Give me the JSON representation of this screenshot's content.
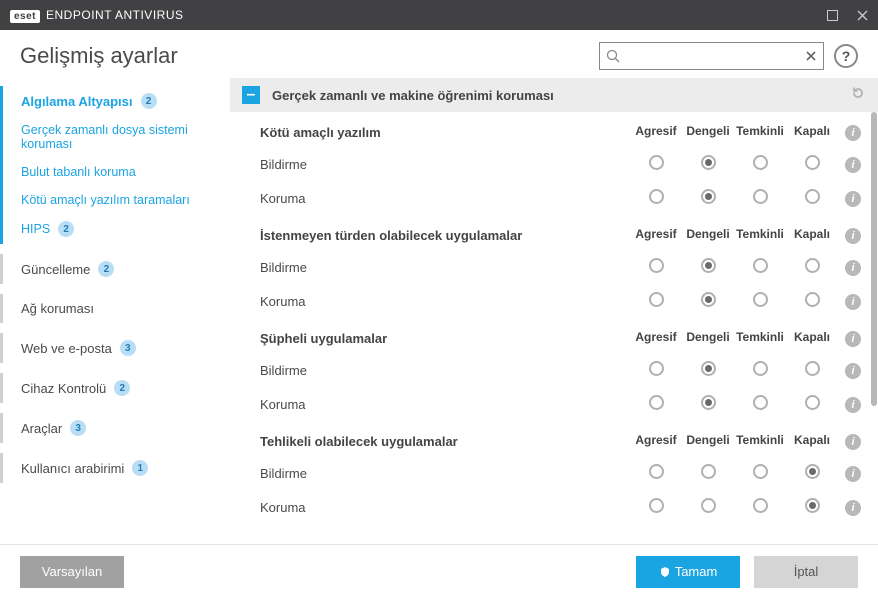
{
  "app": {
    "brand_prefix": "eset",
    "brand": "ENDPOINT ANTIVIRUS"
  },
  "page": {
    "title": "Gelişmiş ayarlar"
  },
  "search": {
    "placeholder": ""
  },
  "sidebar": {
    "items": [
      {
        "label": "Algılama Altyapısı",
        "badge": "2",
        "active": true
      },
      {
        "label": "Gerçek zamanlı dosya sistemi koruması",
        "sub": true
      },
      {
        "label": "Bulut tabanlı koruma",
        "sub": true
      },
      {
        "label": "Kötü amaçlı yazılım taramaları",
        "sub": true
      },
      {
        "label": "HIPS",
        "sub": true,
        "badge": "2"
      },
      {
        "label": "Güncelleme",
        "badge": "2"
      },
      {
        "label": "Ağ koruması"
      },
      {
        "label": "Web ve e-posta",
        "badge": "3"
      },
      {
        "label": "Cihaz Kontrolü",
        "badge": "2"
      },
      {
        "label": "Araçlar",
        "badge": "3"
      },
      {
        "label": "Kullanıcı arabirimi",
        "badge": "1"
      }
    ]
  },
  "section": {
    "title": "Gerçek zamanlı ve makine öğrenimi koruması"
  },
  "columns": [
    "Agresif",
    "Dengeli",
    "Temkinli",
    "Kapalı"
  ],
  "row_labels": {
    "report": "Bildirme",
    "protect": "Koruma"
  },
  "groups": [
    {
      "title": "Kötü amaçlı yazılım",
      "rows": [
        {
          "kind": "report",
          "selected": 1
        },
        {
          "kind": "protect",
          "selected": 1
        }
      ]
    },
    {
      "title": "İstenmeyen türden olabilecek uygulamalar",
      "rows": [
        {
          "kind": "report",
          "selected": 1
        },
        {
          "kind": "protect",
          "selected": 1
        }
      ]
    },
    {
      "title": "Şüpheli uygulamalar",
      "rows": [
        {
          "kind": "report",
          "selected": 1
        },
        {
          "kind": "protect",
          "selected": 1
        }
      ]
    },
    {
      "title": "Tehlikeli olabilecek uygulamalar",
      "rows": [
        {
          "kind": "report",
          "selected": 3
        },
        {
          "kind": "protect",
          "selected": 3
        }
      ]
    }
  ],
  "footer": {
    "default": "Varsayılan",
    "ok": "Tamam",
    "cancel": "İptal"
  }
}
